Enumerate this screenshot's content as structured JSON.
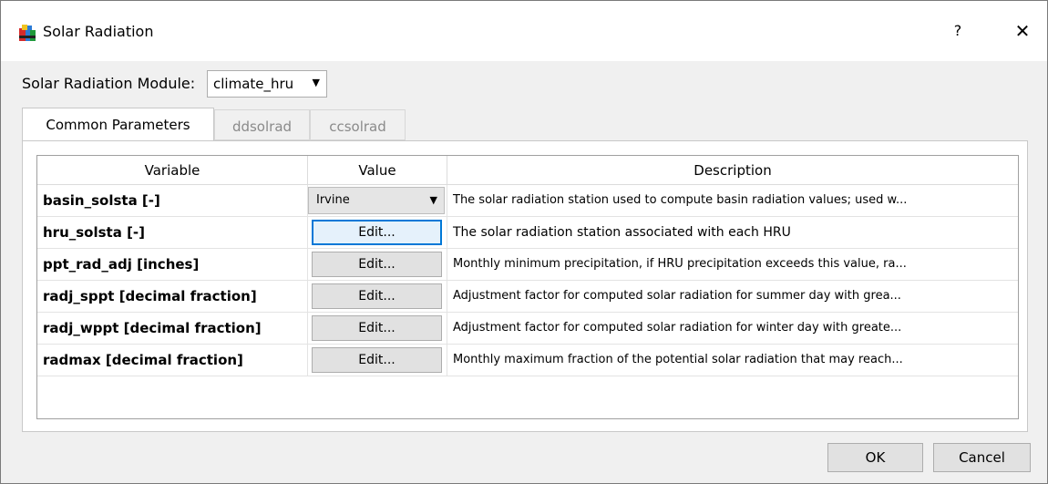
{
  "window": {
    "title": "Solar Radiation",
    "help": "?",
    "close": "✕"
  },
  "module": {
    "label": "Solar Radiation Module:",
    "selected": "climate_hru"
  },
  "tabs": [
    {
      "label": "Common Parameters",
      "active": true
    },
    {
      "label": "ddsolrad",
      "active": false
    },
    {
      "label": "ccsolrad",
      "active": false
    }
  ],
  "table": {
    "headers": {
      "variable": "Variable",
      "value": "Value",
      "description": "Description"
    },
    "rows": [
      {
        "variable": "basin_solsta [-]",
        "value": "Irvine",
        "description": "The solar radiation station used to compute basin radiation values; used w..."
      },
      {
        "variable": "hru_solsta [-]",
        "value": "Edit...",
        "description": "The solar radiation station associated with each HRU"
      },
      {
        "variable": "ppt_rad_adj [inches]",
        "value": "Edit...",
        "description": "Monthly minimum precipitation, if HRU precipitation exceeds this value, ra..."
      },
      {
        "variable": "radj_sppt [decimal fraction]",
        "value": "Edit...",
        "description": "Adjustment factor for computed solar radiation for summer day with grea..."
      },
      {
        "variable": "radj_wppt [decimal fraction]",
        "value": "Edit...",
        "description": "Adjustment factor for computed solar radiation for winter day with greate..."
      },
      {
        "variable": "radmax [decimal fraction]",
        "value": "Edit...",
        "description": "Monthly maximum fraction of the potential solar radiation that may reach..."
      }
    ]
  },
  "buttons": {
    "ok": "OK",
    "cancel": "Cancel"
  }
}
